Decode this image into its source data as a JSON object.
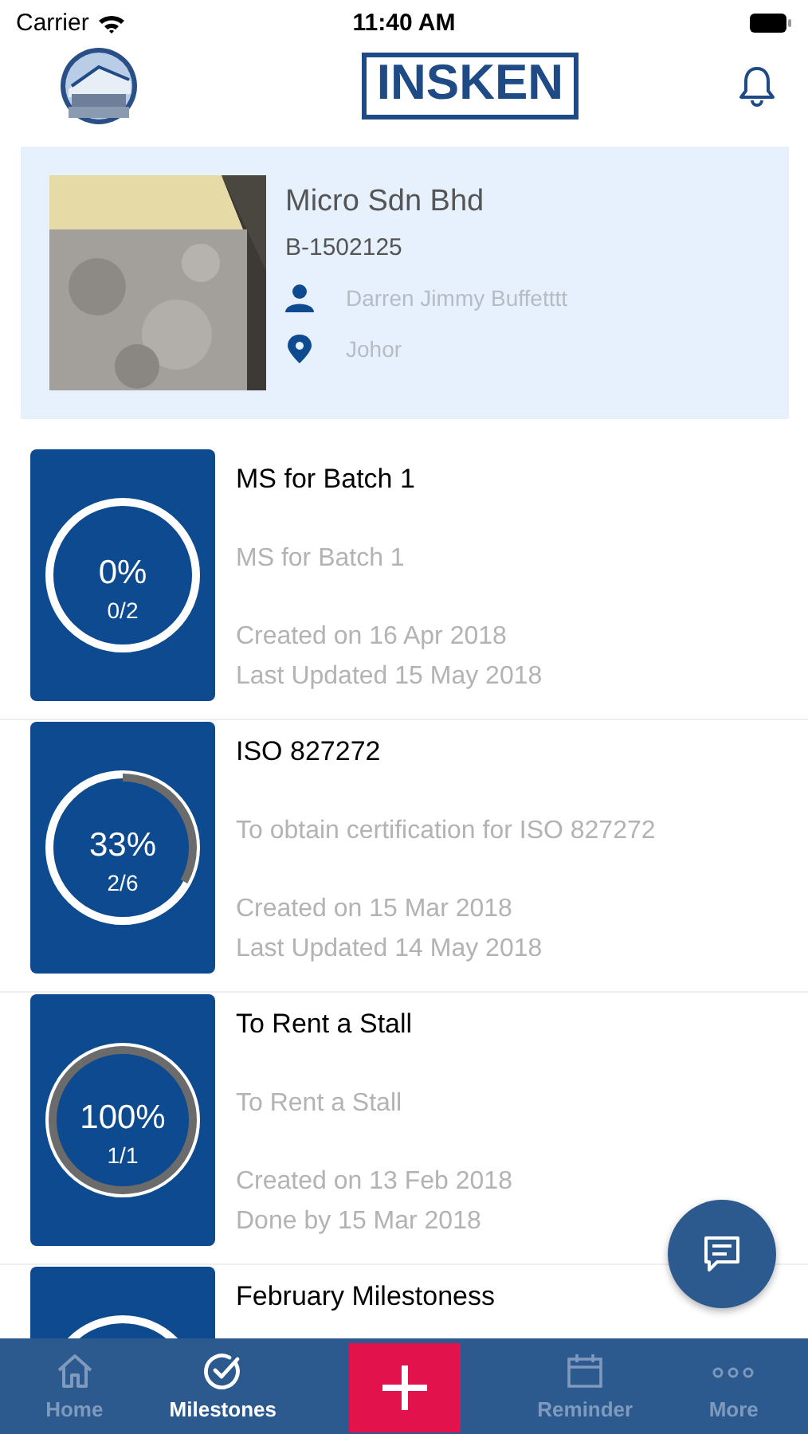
{
  "status_bar": {
    "carrier": "Carrier",
    "time": "11:40 AM"
  },
  "header": {
    "logo": "INSKEN"
  },
  "profile": {
    "company": "Micro Sdn Bhd",
    "code": "B-1502125",
    "person": "Darren Jimmy Buffetttt",
    "location": "Johor"
  },
  "milestones": [
    {
      "title": "MS for Batch 1",
      "percent": "0%",
      "count": "0/2",
      "description": "MS for Batch 1",
      "created": "Created on 16 Apr 2018",
      "updated": "Last Updated 15 May 2018"
    },
    {
      "title": "ISO 827272",
      "percent": "33%",
      "count": "2/6",
      "description": "To obtain certification for ISO 827272",
      "created": "Created on 15 Mar 2018",
      "updated": "Last Updated 14 May 2018"
    },
    {
      "title": "To Rent a Stall",
      "percent": "100%",
      "count": "1/1",
      "description": "To Rent a Stall",
      "created": "Created on 13 Feb 2018",
      "updated": "Done by 15 Mar 2018"
    },
    {
      "title": "February Milestoness"
    }
  ],
  "tabs": [
    {
      "kind": "home",
      "label": "Home",
      "selected": false
    },
    {
      "kind": "check",
      "label": "Milestones",
      "selected": true
    },
    {
      "kind": "add",
      "selected": false
    },
    {
      "kind": "calendar",
      "label": "Reminder",
      "selected": false
    },
    {
      "kind": "more",
      "label": "More",
      "selected": false
    }
  ]
}
